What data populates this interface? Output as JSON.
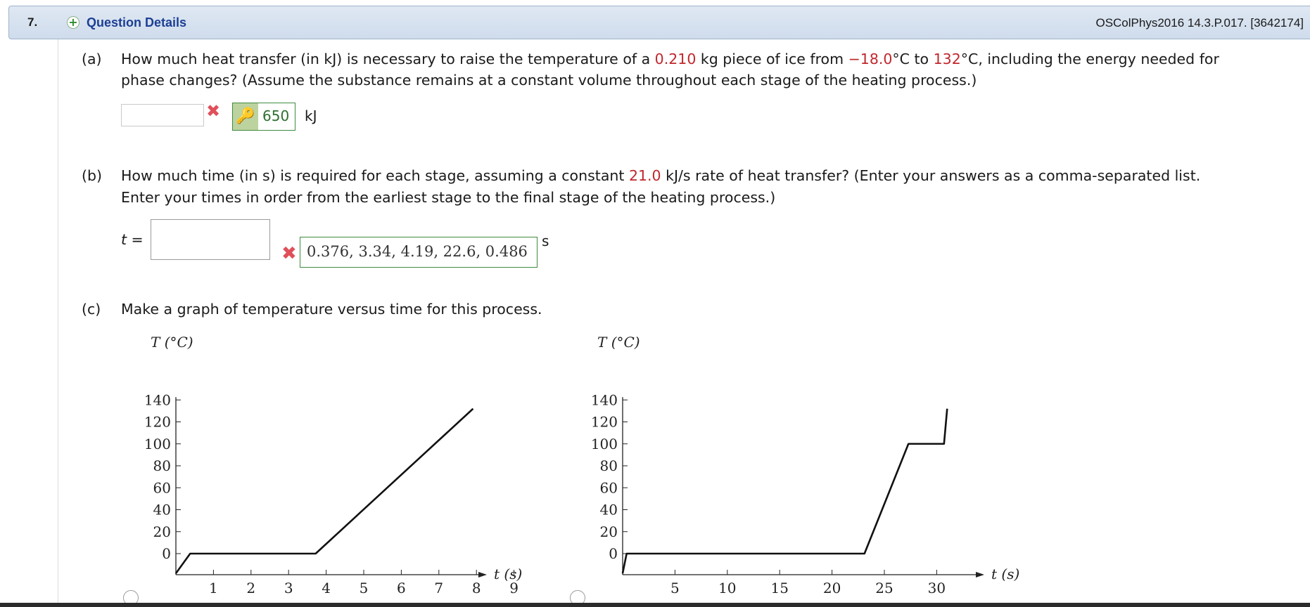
{
  "header": {
    "number": "7.",
    "details_label": "Question Details",
    "reference": "OSColPhys2016 14.3.P.017. [3642174]"
  },
  "parts": {
    "a": {
      "label": "(a)",
      "line1_pre": "How much heat transfer (in kJ) is necessary to raise the temperature of a ",
      "mass": "0.210",
      "line1_mid1": " kg piece of ice from ",
      "t_from": "−18.0",
      "line1_mid2": "°C to ",
      "t_to": "132",
      "line1_post": "°C, including the energy needed for",
      "line2": "phase changes? (Assume the substance remains at a constant volume throughout each stage of the heating process.)",
      "input_value": "",
      "mark": "✖",
      "key_answer": "650",
      "unit": "kJ"
    },
    "b": {
      "label": "(b)",
      "line1_pre": "How much time (in s) is required for each stage, assuming a constant ",
      "rate": "21.0",
      "line1_post": " kJ/s rate of heat transfer? (Enter your answers as a comma-separated list.",
      "line2": "Enter your times in order from the earliest stage to the final stage of the heating process.)",
      "var_label": "t =",
      "input_value": "",
      "mark": "✖",
      "answer": "0.376, 3.34, 4.19, 22.6, 0.486",
      "unit": "s"
    },
    "c": {
      "label": "(c)",
      "text": "Make a graph of temperature versus time for this process."
    }
  },
  "chart_data": [
    {
      "type": "line",
      "ylabel": "T (°C)",
      "xlabel": "t (s)",
      "yticks": [
        0,
        20,
        40,
        60,
        80,
        100,
        120,
        140
      ],
      "xticks": [
        1,
        2,
        3,
        4,
        5,
        6,
        7,
        8,
        9
      ],
      "xlim": [
        0,
        9
      ],
      "ylim": [
        -18,
        140
      ],
      "series": [
        {
          "x": [
            0,
            0.38,
            3.72,
            7.91
          ],
          "y": [
            -18,
            0,
            0,
            132
          ]
        }
      ]
    },
    {
      "type": "line",
      "ylabel": "T (°C)",
      "xlabel": "t (s)",
      "yticks": [
        0,
        20,
        40,
        60,
        80,
        100,
        120,
        140
      ],
      "xticks": [
        5,
        10,
        15,
        20,
        25,
        30
      ],
      "xlim": [
        0,
        32
      ],
      "ylim": [
        -18,
        140
      ],
      "series": [
        {
          "x": [
            0,
            0.38,
            23.1,
            27.3,
            30.7,
            31.0
          ],
          "y": [
            -18,
            0,
            0,
            100,
            100,
            132
          ]
        }
      ]
    }
  ]
}
